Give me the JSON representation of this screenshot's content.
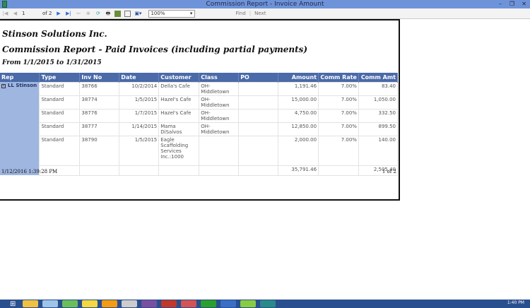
{
  "window": {
    "title": "Commission Report - Invoice Amount"
  },
  "toolbar": {
    "page": "1",
    "of_pages": "of 2",
    "zoom": "100%",
    "find": "Find",
    "next": "Next"
  },
  "report": {
    "company": "Stinson Solutions Inc.",
    "title": "Commission Report - Paid Invoices (including partial payments)",
    "date_range": "From 1/1/2015 to 1/31/2015",
    "columns": [
      "Rep",
      "Type",
      "Inv No",
      "Date",
      "Customer",
      "Class",
      "PO",
      "Amount",
      "Comm Rate",
      "Comm Amt"
    ],
    "rep": "LL Stinson",
    "rows": [
      {
        "type": "Standard",
        "inv": "38766",
        "date": "10/2/2014",
        "customer": "Della's Cafe",
        "class": "OH-Middletown",
        "po": "",
        "amount": "1,191.46",
        "rate": "7.00%",
        "comm": "83.40"
      },
      {
        "type": "Standard",
        "inv": "38774",
        "date": "1/5/2015",
        "customer": "Hazel's Cafe",
        "class": "OH-Middletown",
        "po": "",
        "amount": "15,000.00",
        "rate": "7.00%",
        "comm": "1,050.00"
      },
      {
        "type": "Standard",
        "inv": "38776",
        "date": "1/7/2015",
        "customer": "Hazel's Cafe",
        "class": "OH-Middletown",
        "po": "",
        "amount": "4,750.00",
        "rate": "7.00%",
        "comm": "332.50"
      },
      {
        "type": "Standard",
        "inv": "38777",
        "date": "1/14/2015",
        "customer": "Mama DiSalvos",
        "class": "OH-Middletown",
        "po": "",
        "amount": "12,850.00",
        "rate": "7.00%",
        "comm": "899.50"
      },
      {
        "type": "Standard",
        "inv": "38790",
        "date": "1/5/2015",
        "customer": "Eagle Scaffolding Services Inc.:1000",
        "class": "",
        "po": "",
        "amount": "2,000.00",
        "rate": "7.00%",
        "comm": "140.00"
      }
    ],
    "total_amount": "35,791.46",
    "total_comm": "2,505.40",
    "printed": "1/12/2016 1:39:28 PM",
    "page_of": "1 of 2"
  },
  "taskbar": {
    "clock": "1:40 PM",
    "colors": [
      "#f0c040",
      "#9ec4e8",
      "#6bbf59",
      "#f5d742",
      "#f39c12",
      "#ccc",
      "#7b4fa0",
      "#c0392b",
      "#d35454",
      "#2ca02c",
      "#3b6fc6",
      "#88cc44",
      "#2a8a8a"
    ]
  }
}
